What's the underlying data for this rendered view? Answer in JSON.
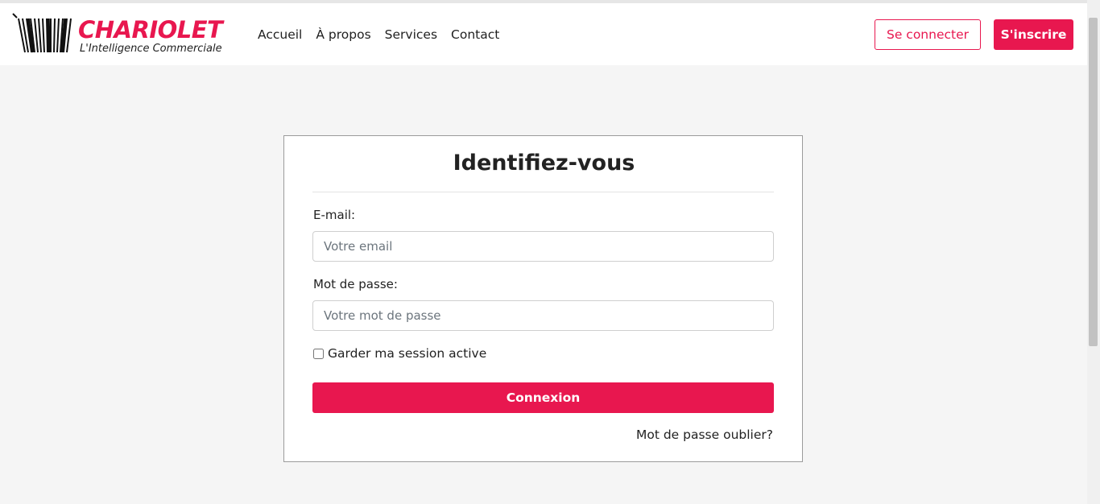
{
  "brand": {
    "name": "CHARIOLET",
    "tagline": "L'Intelligence Commerciale",
    "accent_color": "#e8174f"
  },
  "nav": {
    "links": [
      "Accueil",
      "À propos",
      "Services",
      "Contact"
    ],
    "login_label": "Se connecter",
    "signup_label": "S'inscrire"
  },
  "login_form": {
    "title": "Identifiez-vous",
    "email_label": "E-mail:",
    "email_placeholder": "Votre email",
    "password_label": "Mot de passe:",
    "password_placeholder": "Votre mot de passe",
    "remember_label": "Garder ma session active",
    "remember_checked": false,
    "submit_label": "Connexion",
    "forgot_label": "Mot de passe oublier?"
  }
}
